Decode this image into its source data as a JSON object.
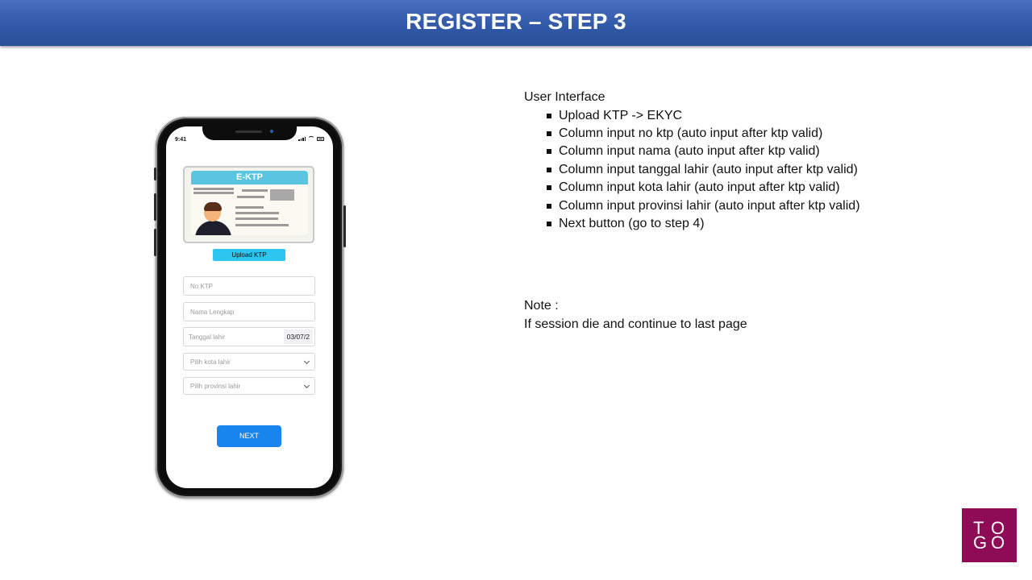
{
  "header": {
    "title": "REGISTER – STEP 3"
  },
  "phone": {
    "status_time": "9:41",
    "ktp_card_title": "E-KTP",
    "upload_button_label": "Upload KTP",
    "fields": {
      "no_ktp_placeholder": "No KTP",
      "nama_placeholder": "Nama Lengkap",
      "tanggal_placeholder": "Tanggal lahir",
      "tanggal_value": "03/07/2",
      "kota_placeholder": "Pilih kota lahir",
      "provinsi_placeholder": "Pilih provinsi lahir"
    },
    "next_button_label": "NEXT"
  },
  "info": {
    "title": "User Interface",
    "items": [
      "Upload KTP -> EKYC",
      "Column input no ktp (auto input after ktp valid)",
      "Column input nama (auto input after ktp valid)",
      "Column input tanggal lahir (auto input after ktp valid)",
      "Column input kota lahir (auto input after ktp valid)",
      "Column input provinsi lahir (auto input after ktp valid)",
      "Next button (go to step 4)"
    ]
  },
  "note": {
    "label": "Note :",
    "text": "If session die and continue to last page"
  },
  "logo": {
    "letters": [
      "T",
      "O",
      "G",
      "O"
    ],
    "background": "#8e0b55"
  }
}
